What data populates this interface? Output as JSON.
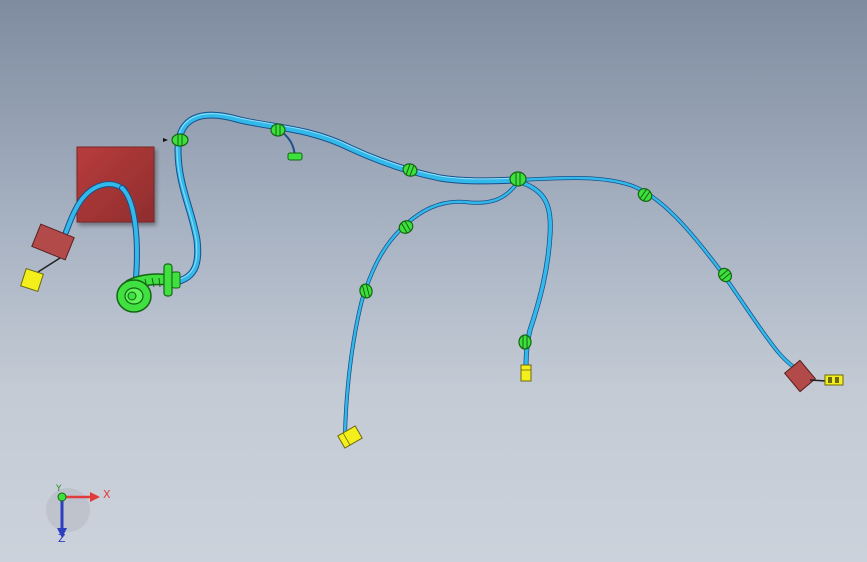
{
  "viewport": {
    "background_top": "#7f8ca0",
    "background_bottom": "#ccd2db"
  },
  "colors": {
    "wire_outer": "#1a4f8a",
    "wire_inner": "#32b9ea",
    "wire_highlight": "#a8e9ff",
    "clip_green": "#3ee03b",
    "clip_dark": "#146414",
    "connector_red": "#b33a3a",
    "connector_yellow": "#f3ee1c",
    "grommet_green": "#40e040"
  },
  "triad": {
    "x_label": "X",
    "y_label": "Y",
    "z_label": "Z"
  }
}
